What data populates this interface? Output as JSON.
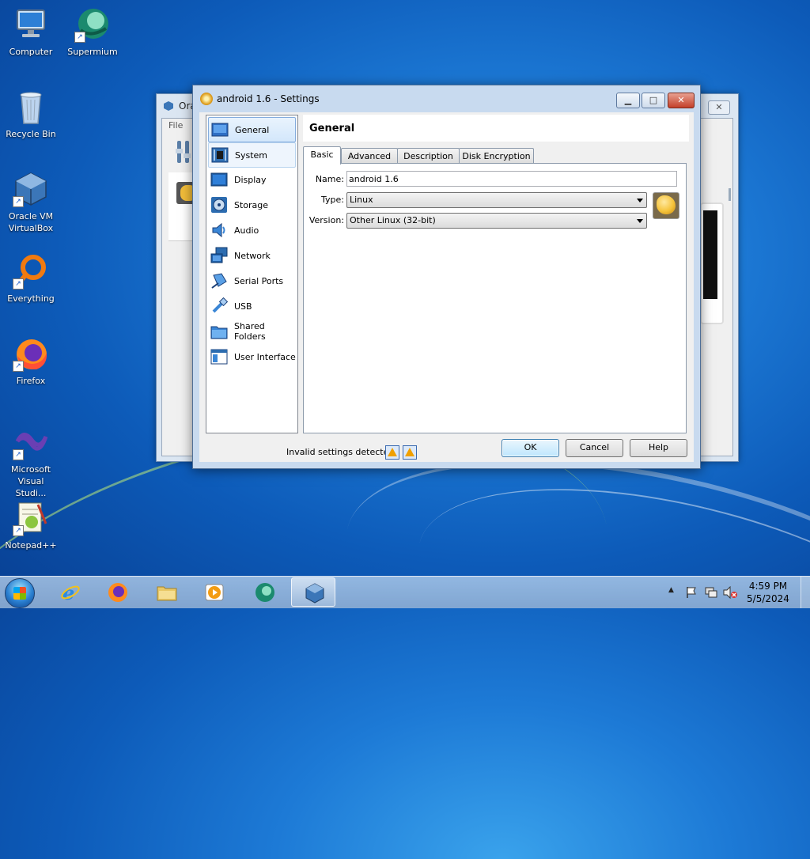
{
  "desktop": {
    "icons": [
      {
        "label": "Computer",
        "icon": "computer-icon"
      },
      {
        "label": "Supermium",
        "icon": "supermium-icon"
      },
      {
        "label": "Recycle Bin",
        "icon": "recycle-bin-icon"
      },
      {
        "label": "Oracle VM VirtualBox",
        "icon": "virtualbox-icon"
      },
      {
        "label": "Everything",
        "icon": "everything-icon"
      },
      {
        "label": "Firefox",
        "icon": "firefox-icon"
      },
      {
        "label": "Microsoft Visual Studi...",
        "icon": "visual-studio-icon"
      },
      {
        "label": "Notepad++",
        "icon": "notepadpp-icon"
      }
    ]
  },
  "back_window": {
    "title": "Ora",
    "menu_file": "File",
    "close_glyph": "✕"
  },
  "dialog": {
    "title": "android 1.6 - Settings",
    "title_buttons": {
      "minimize": "▁",
      "maximize": "□",
      "close": "✕"
    },
    "nav_items": [
      {
        "label": "General",
        "icon": "general-icon"
      },
      {
        "label": "System",
        "icon": "system-icon"
      },
      {
        "label": "Display",
        "icon": "display-icon"
      },
      {
        "label": "Storage",
        "icon": "storage-icon"
      },
      {
        "label": "Audio",
        "icon": "audio-icon"
      },
      {
        "label": "Network",
        "icon": "network-icon"
      },
      {
        "label": "Serial Ports",
        "icon": "serial-ports-icon"
      },
      {
        "label": "USB",
        "icon": "usb-icon"
      },
      {
        "label": "Shared Folders",
        "icon": "shared-folders-icon"
      },
      {
        "label": "User Interface",
        "icon": "user-interface-icon"
      }
    ],
    "selected_nav": "General",
    "section_title": "General",
    "tabs": [
      {
        "label": "Basic"
      },
      {
        "label": "Advanced"
      },
      {
        "label": "Description"
      },
      {
        "label": "Disk Encryption"
      }
    ],
    "active_tab": "Basic",
    "form": {
      "name_label": "Name:",
      "name_value": "android 1.6",
      "type_label": "Type:",
      "type_value": "Linux",
      "version_label": "Version:",
      "version_value": "Other Linux (32-bit)"
    },
    "status_text": "Invalid settings detected",
    "buttons": {
      "ok": "OK",
      "cancel": "Cancel",
      "help": "Help"
    }
  },
  "taskbar": {
    "items": [
      {
        "icon": "internet-explorer-icon"
      },
      {
        "icon": "firefox-icon"
      },
      {
        "icon": "file-explorer-icon"
      },
      {
        "icon": "media-player-icon"
      },
      {
        "icon": "supermium-icon"
      },
      {
        "icon": "virtualbox-icon"
      }
    ],
    "active_item": "virtualbox-icon",
    "tray_expand": "▲",
    "clock_time": "4:59 PM",
    "clock_date": "5/5/2024"
  }
}
